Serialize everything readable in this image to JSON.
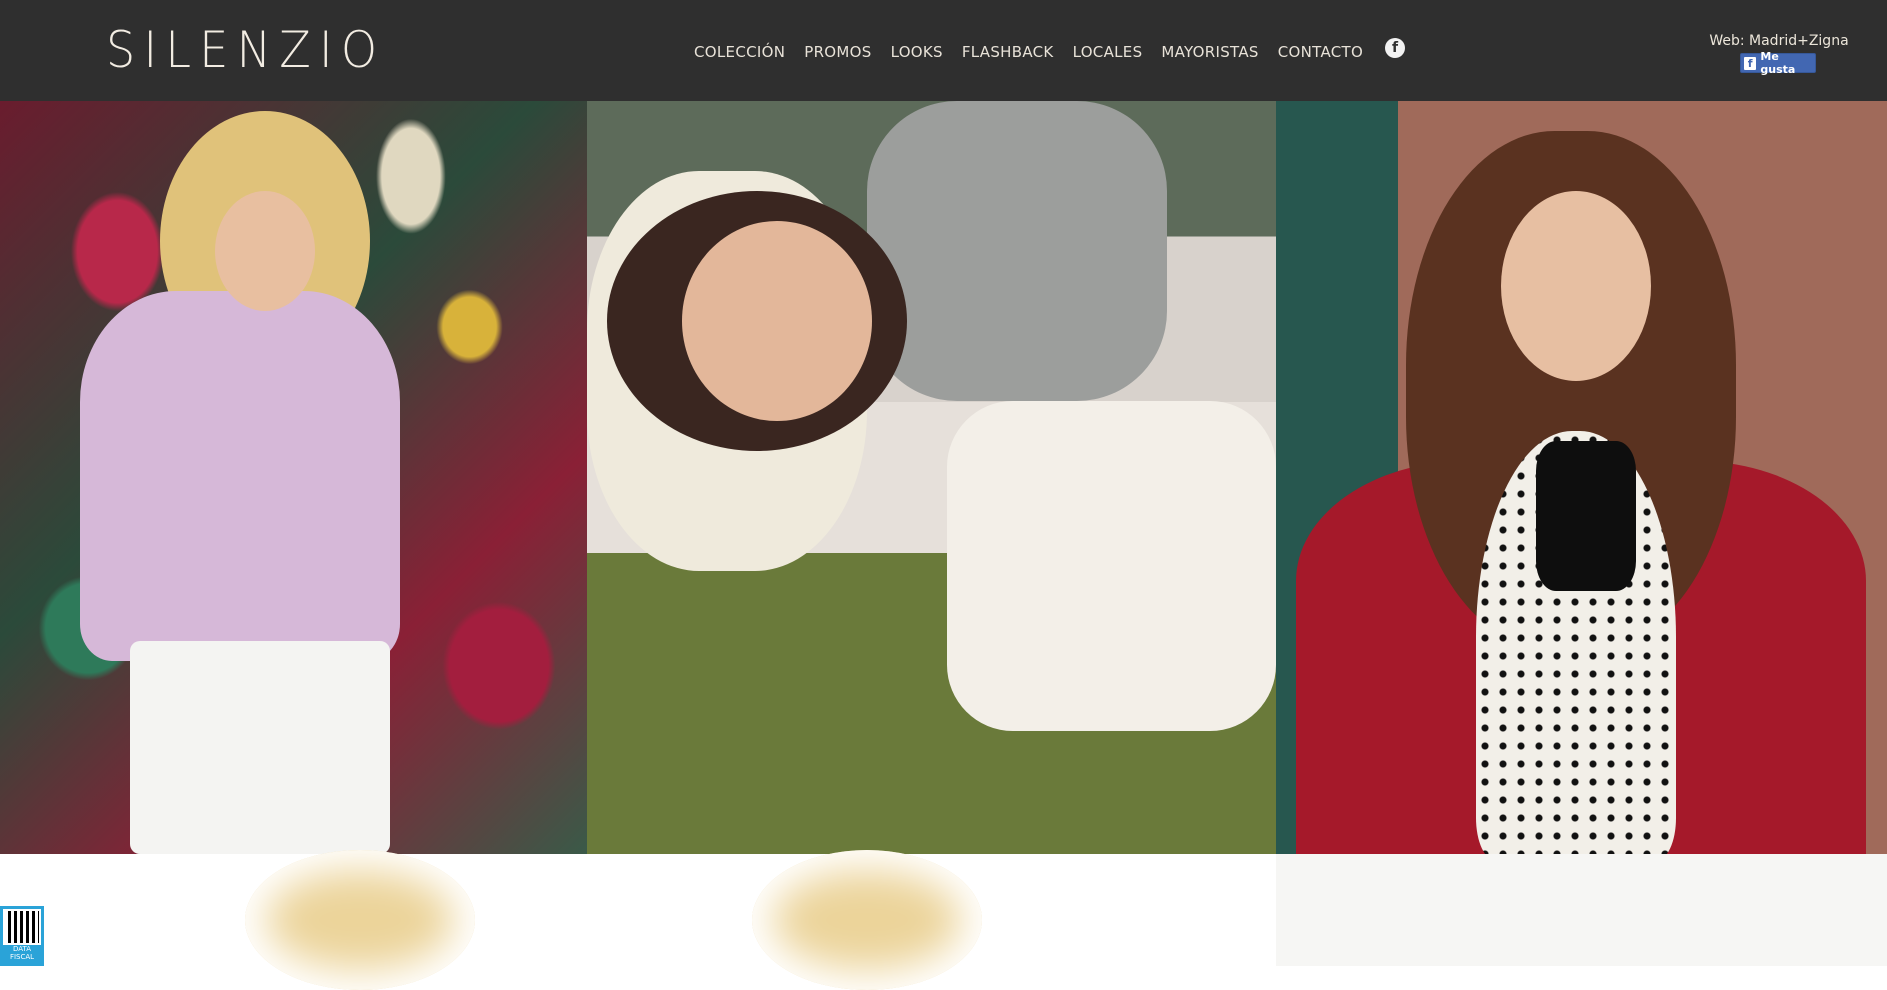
{
  "header": {
    "logo_text": "SILENZIO",
    "nav": [
      "COLECCIÓN",
      "PROMOS",
      "LOOKS",
      "FLASHBACK",
      "LOCALES",
      "MAYORISTAS",
      "CONTACTO"
    ],
    "facebook_icon": "facebook-icon",
    "credit": "Web: Madrid+Zigna",
    "like_label": "Me gusta"
  },
  "gallery": {
    "photos": [
      "Blonde model in lilac shirt lying on floral fabric",
      "Dark-haired model smiling, lying on grass",
      "Model with long brown hair in polka-dot blouse and red coat with fur collar"
    ]
  },
  "badge": {
    "label": "DATA FISCAL"
  },
  "colors": {
    "header_bg": "#2f2f2f",
    "nav_text": "#e8e2d8",
    "like_blue": "#4267b2",
    "badge_blue": "#2aa3d8"
  }
}
